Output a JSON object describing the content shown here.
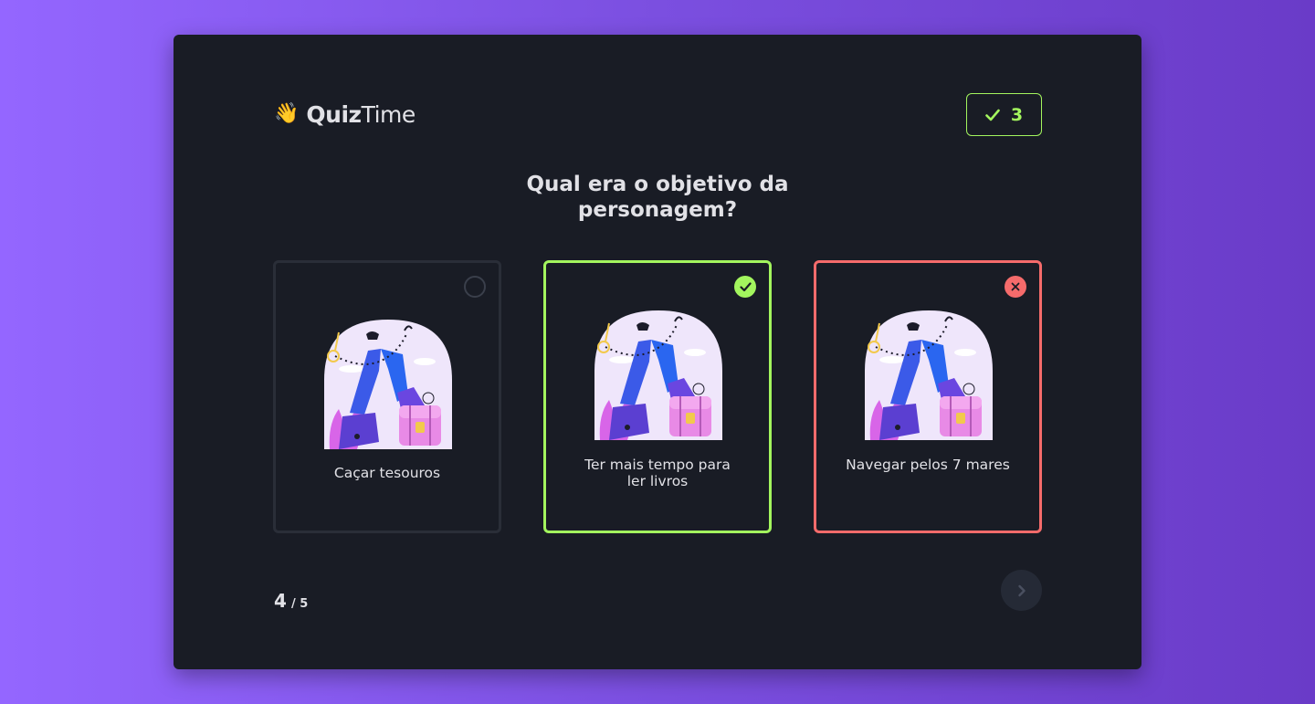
{
  "app": {
    "logo_emoji": "👋",
    "logo_bold": "Quiz",
    "logo_regular": "Time"
  },
  "score": {
    "icon": "check-icon",
    "value": "3"
  },
  "question": "Qual era o objetivo da personagem?",
  "options": [
    {
      "label": "Caçar tesouros",
      "state": "unselected",
      "status_icon": "radio-circle-icon"
    },
    {
      "label": "Ter mais tempo para ler livros",
      "state": "correct",
      "status_icon": "check-circle-icon"
    },
    {
      "label": "Navegar pelos 7 mares",
      "state": "wrong",
      "status_icon": "x-circle-icon"
    }
  ],
  "progress": {
    "current": "4",
    "total": "/ 5"
  },
  "next_button": {
    "icon": "chevron-right-icon"
  },
  "colors": {
    "correct": "#a3f55e",
    "wrong": "#f56b6b",
    "background": "#191c25",
    "text": "#e1e1e6"
  }
}
